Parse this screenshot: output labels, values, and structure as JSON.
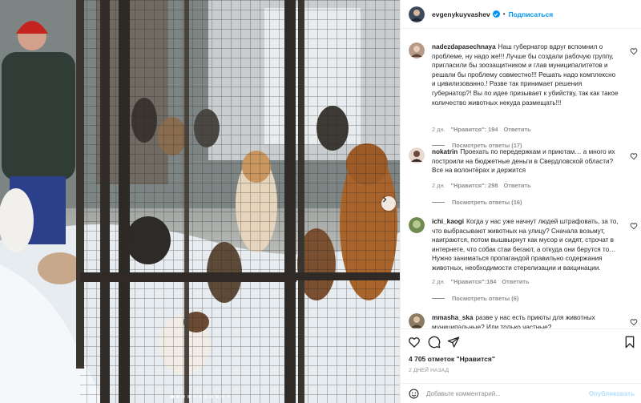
{
  "post": {
    "username": "evgenykuyvashev",
    "separator": "•",
    "follow_label": "Подписаться",
    "likes_text": "4 705 отметок \"Нравится\"",
    "time_ago": "2 ДНЕЙ НАЗАД",
    "photo_count": 11,
    "photo_active_index": 0,
    "icons": {
      "verified": "verified-badge-icon",
      "like": "heart-icon",
      "comment": "comment-icon",
      "share": "paper-plane-icon",
      "save": "bookmark-icon",
      "emoji": "emoji-icon",
      "next": "chevron-right-icon"
    }
  },
  "comments": [
    {
      "username": "nadezdapasechnaya",
      "text": "Наш губернатор вдруг вспомнил о проблеме, ну надо же!!! Лучше бы создали рабочую группу, пригласили бы зоозащитником и глав муниципалитетов и решали бы проблему совместно!!! Решать надо комплексно и цивилизованно.! Разве так принимает решения губернатор?! Вы по идее призывает к убийству, так как такое количество животных некуда размещать!!!",
      "time": "2 дн.",
      "likes": "\"Нравится\": 194",
      "reply": "Ответить",
      "view_replies": "Посмотреть ответы (17)"
    },
    {
      "username": "nokatrin",
      "text": "Проехать по передержкам и приютам… а много их построили на бюджетные деньги в Свердловской области? Все на волонтёрах и держится",
      "time": "2 дн.",
      "likes": "\"Нравится\": 298",
      "reply": "Ответить",
      "view_replies": "Посмотреть ответы (16)"
    },
    {
      "username": "ichi_kaogi",
      "text": "Когда у нас уже начнут людей штрафовать, за то, что выбрасывают животных на улицу? Сначала возьмут, наиграются, потом вышвырнут как мусор и сидят, строчат в интернете, что собак стаи бегают, а откуда они берутся то… Нужно заниматься пропагандой правильно содержания животных, необходимости стерелизации и вакцинации.",
      "time": "2 дн.",
      "likes": "\"Нравится\":184",
      "reply": "Ответить",
      "view_replies": "Посмотреть ответы (6)"
    },
    {
      "username": "mmasha_ska",
      "text": "разве у нас есть приюты для животных муниципальные? Или только частные?"
    }
  ],
  "composer": {
    "placeholder": "Добавьте комментарий...",
    "publish_label": "Опубликовать"
  }
}
